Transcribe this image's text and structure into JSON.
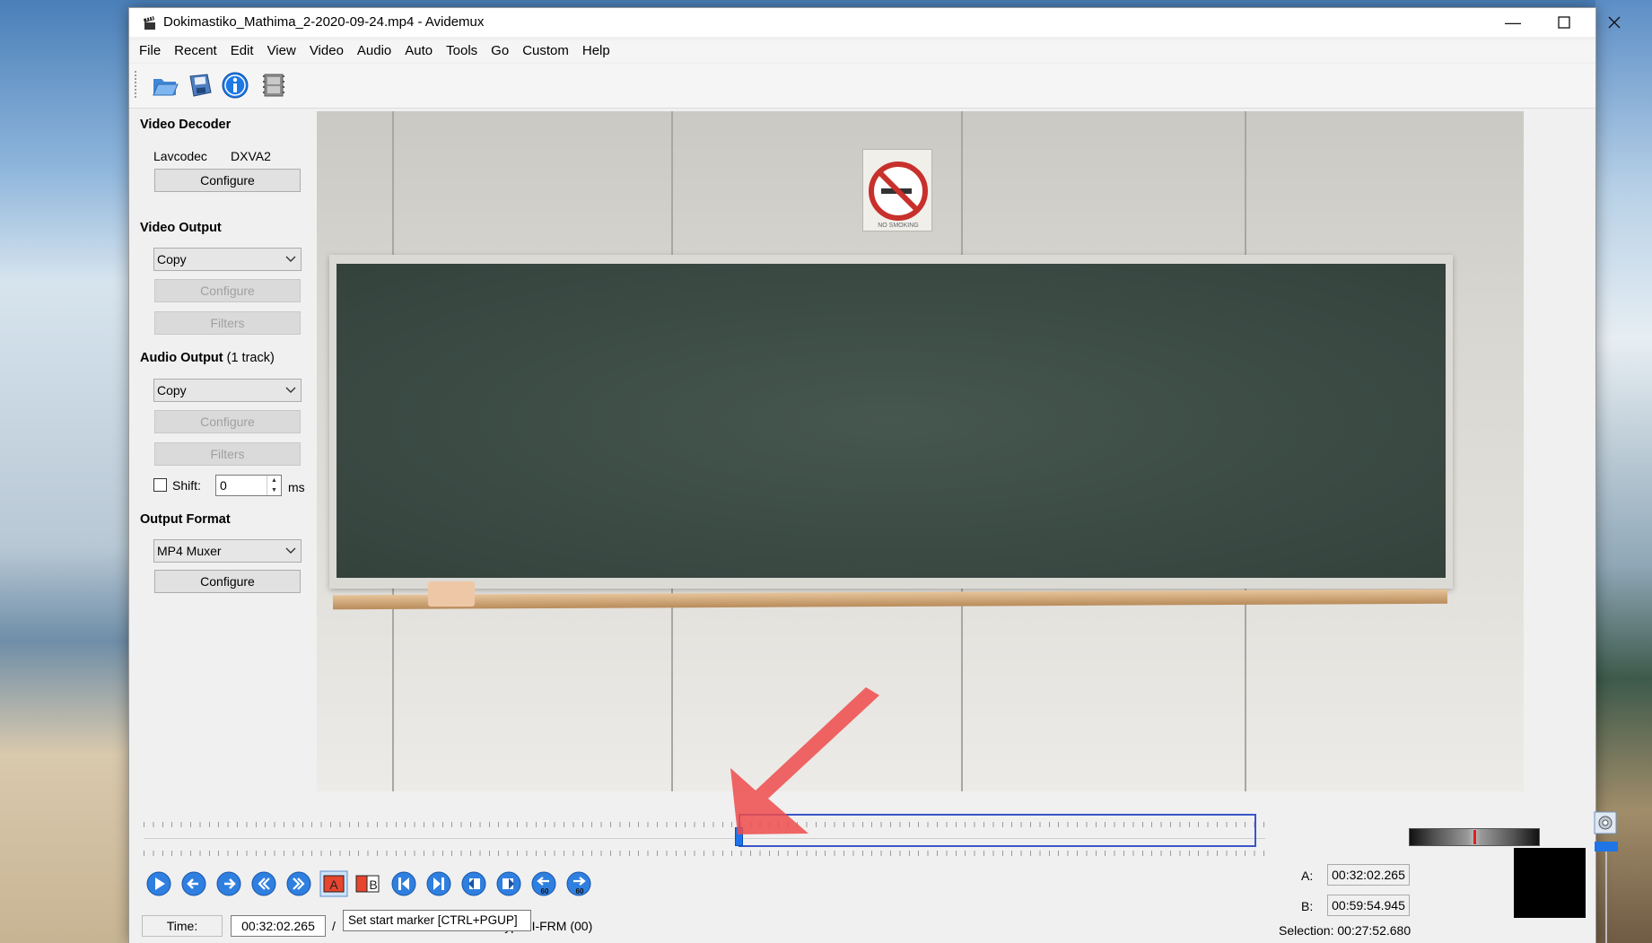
{
  "window": {
    "title": "Dokimastiko_Mathima_2-2020-09-24.mp4 - Avidemux"
  },
  "menu": [
    "File",
    "Recent",
    "Edit",
    "View",
    "Video",
    "Audio",
    "Auto",
    "Tools",
    "Go",
    "Custom",
    "Help"
  ],
  "toolbar": {
    "icons": [
      "open-folder-icon",
      "save-icon",
      "info-icon",
      "film-properties-icon"
    ]
  },
  "video_decoder": {
    "title": "Video Decoder",
    "decoder": "Lavcodec",
    "hw": "DXVA2",
    "configure": "Configure"
  },
  "video_output": {
    "title": "Video Output",
    "codec": "Copy",
    "configure": "Configure",
    "filters": "Filters"
  },
  "audio_output": {
    "title": "Audio Output",
    "tracks": "(1 track)",
    "codec": "Copy",
    "configure": "Configure",
    "filters": "Filters",
    "shift_label": "Shift:",
    "shift_value": "0",
    "shift_unit": "ms"
  },
  "output_format": {
    "title": "Output Format",
    "muxer": "MP4 Muxer",
    "configure": "Configure"
  },
  "video_frame": {
    "sign_text": "NO SMOKING"
  },
  "controls": {
    "buttons": [
      "play-icon",
      "previous-frame-icon",
      "next-frame-icon",
      "previous-keyframe-icon",
      "next-keyframe-icon",
      "set-start-marker-icon",
      "set-end-marker-icon",
      "goto-marker-a-icon",
      "goto-marker-b-icon",
      "previous-black-frame-icon",
      "next-black-frame-icon",
      "back-60s-icon",
      "forward-60s-icon"
    ]
  },
  "status": {
    "time_label": "Time:",
    "time_value": "00:32:02.265",
    "total_prefix": "/",
    "frame_type": "Frame type: I-FRM (00)",
    "tooltip": "Set start marker [CTRL+PGUP]",
    "a_label": "A:",
    "a_value": "00:32:02.265",
    "b_label": "B:",
    "b_value": "00:59:54.945",
    "selection": "Selection: 00:27:52.680"
  },
  "colors": {
    "accent": "#1e73e8",
    "selection": "#3a56c8",
    "annotation_arrow": "#ef4b4b"
  }
}
